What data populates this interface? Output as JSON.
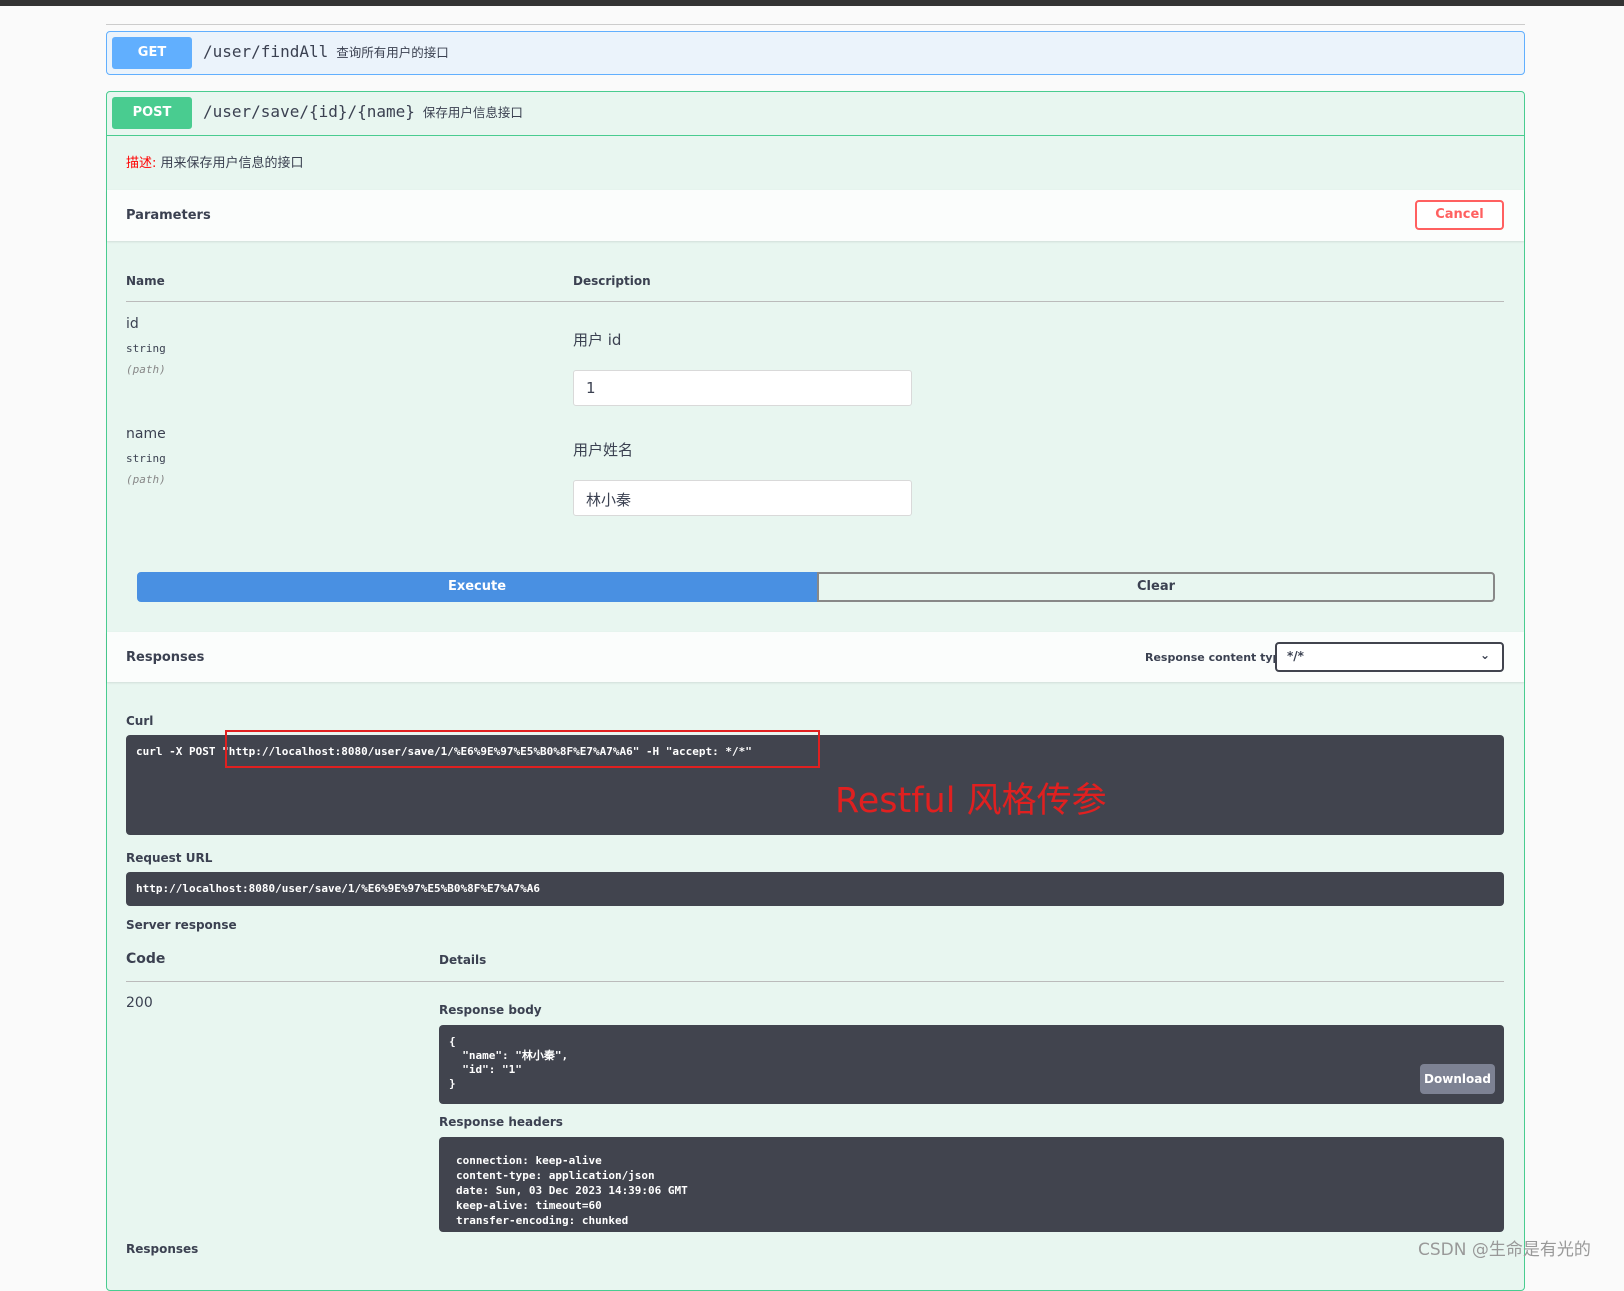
{
  "get": {
    "method": "GET",
    "path": "/user/findAll",
    "summary": "查询所有用户的接口",
    "color": "#61affe"
  },
  "post": {
    "method": "POST",
    "path": "/user/save/{id}/{name}",
    "summary": "保存用户信息接口",
    "color": "#49cc90",
    "desc_label": "描述:",
    "desc_text": "用来保存用户信息的接口",
    "parameters_title": "Parameters",
    "cancel_label": "Cancel",
    "col_name": "Name",
    "col_description": "Description",
    "params": [
      {
        "name": "id",
        "type": "string",
        "in": "(path)",
        "description": "用户 id",
        "value": "1"
      },
      {
        "name": "name",
        "type": "string",
        "in": "(path)",
        "description": "用户姓名",
        "value": "林小秦"
      }
    ],
    "execute_label": "Execute",
    "clear_label": "Clear",
    "responses_title": "Responses",
    "content_type_label": "Response content type",
    "content_type_value": "*/*",
    "curl_label": "Curl",
    "curl_prefix": "curl -X POST ",
    "curl_highlight": "\"http://localhost:8080/user/save/1/%E6%9E%97%E5%B0%8F%E7%A7%A6\" -H \"accept: */*\"",
    "annotation": "Restful 风格传参",
    "request_url_label": "Request URL",
    "request_url": "http://localhost:8080/user/save/1/%E6%9E%97%E5%B0%8F%E7%A7%A6",
    "server_response_label": "Server response",
    "code_header": "Code",
    "details_header": "Details",
    "code": "200",
    "response_body_label": "Response body",
    "response_body": "{\n  \"name\": \"林小秦\",\n  \"id\": \"1\"\n}",
    "download_label": "Download",
    "response_headers_label": "Response headers",
    "response_headers": "connection: keep-alive\ncontent-type: application/json\ndate: Sun, 03 Dec 2023 14:39:06 GMT\nkeep-alive: timeout=60\ntransfer-encoding: chunked",
    "responses_bottom": "Responses"
  },
  "watermark": "CSDN @生命是有光的"
}
